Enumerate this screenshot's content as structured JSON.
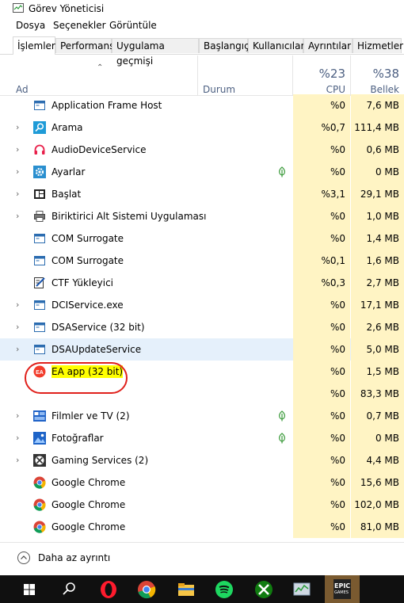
{
  "window": {
    "title": "Görev Yöneticisi"
  },
  "menu": [
    "Dosya",
    "Seçenekler",
    "Görüntüle"
  ],
  "tabs": [
    "İşlemler",
    "Performans",
    "Uygulama geçmişi",
    "Başlangıç",
    "Kullanıcılar",
    "Ayrıntılar",
    "Hizmetler"
  ],
  "columns": {
    "name": "Ad",
    "status": "Durum",
    "cpu_pct": "%23",
    "cpu_label": "CPU",
    "mem_pct": "%38",
    "mem_label": "Bellek"
  },
  "processes": [
    {
      "name": "Application Frame Host",
      "cpu": "%0",
      "mem": "7,6 MB",
      "icon": "window-icon",
      "expandable": false
    },
    {
      "name": "Arama",
      "cpu": "%0,7",
      "mem": "111,4 MB",
      "icon": "search-icon",
      "expandable": true
    },
    {
      "name": "AudioDeviceService",
      "cpu": "%0",
      "mem": "0,6 MB",
      "icon": "headphones-icon",
      "expandable": true
    },
    {
      "name": "Ayarlar",
      "cpu": "%0",
      "mem": "0 MB",
      "icon": "gear-icon",
      "expandable": true,
      "suspended": true
    },
    {
      "name": "Başlat",
      "cpu": "%3,1",
      "mem": "29,1 MB",
      "icon": "start-icon",
      "expandable": true
    },
    {
      "name": "Biriktirici Alt Sistemi Uygulaması",
      "cpu": "%0",
      "mem": "1,0 MB",
      "icon": "printer-icon",
      "expandable": true
    },
    {
      "name": "COM Surrogate",
      "cpu": "%0",
      "mem": "1,4 MB",
      "icon": "window-icon",
      "expandable": false
    },
    {
      "name": "COM Surrogate",
      "cpu": "%0,1",
      "mem": "1,6 MB",
      "icon": "window-icon",
      "expandable": false
    },
    {
      "name": "CTF Yükleyici",
      "cpu": "%0,3",
      "mem": "2,7 MB",
      "icon": "pen-icon",
      "expandable": false
    },
    {
      "name": "DCIService.exe",
      "cpu": "%0",
      "mem": "17,1 MB",
      "icon": "window-icon",
      "expandable": true
    },
    {
      "name": "DSAService (32 bit)",
      "cpu": "%0",
      "mem": "2,6 MB",
      "icon": "window-icon",
      "expandable": true
    },
    {
      "name": "DSAUpdateService",
      "cpu": "%0",
      "mem": "5,0 MB",
      "icon": "window-icon",
      "expandable": true,
      "highlight": true
    },
    {
      "name": "EA app (32 bit)",
      "cpu": "%0",
      "mem": "1,5 MB",
      "icon": "ea-icon",
      "expandable": false,
      "marked": true
    },
    {
      "name": "",
      "cpu": "%0",
      "mem": "83,3 MB",
      "icon": "",
      "expandable": false
    },
    {
      "name": "Filmler ve TV (2)",
      "cpu": "%0",
      "mem": "0,7 MB",
      "icon": "film-icon",
      "expandable": true,
      "suspended": true
    },
    {
      "name": "Fotoğraflar",
      "cpu": "%0",
      "mem": "0 MB",
      "icon": "photo-icon",
      "expandable": true,
      "suspended": true
    },
    {
      "name": "Gaming Services (2)",
      "cpu": "%0",
      "mem": "4,4 MB",
      "icon": "xbox-icon",
      "expandable": true
    },
    {
      "name": "Google Chrome",
      "cpu": "%0",
      "mem": "15,6 MB",
      "icon": "chrome-icon",
      "expandable": false
    },
    {
      "name": "Google Chrome",
      "cpu": "%0",
      "mem": "102,0 MB",
      "icon": "chrome-icon",
      "expandable": false
    },
    {
      "name": "Google Chrome",
      "cpu": "%0",
      "mem": "81,0 MB",
      "icon": "chrome-icon",
      "expandable": false
    }
  ],
  "footer": {
    "fewer_details": "Daha az ayrıntı"
  },
  "taskbar": {
    "epic_label": "EPIC",
    "epic_sub": "GAMES"
  },
  "colors": {
    "cpu_bg": "#fff4c4",
    "highlight": "#e5f0fb",
    "annotation": "#e0201b",
    "header_text": "#4d6082"
  }
}
